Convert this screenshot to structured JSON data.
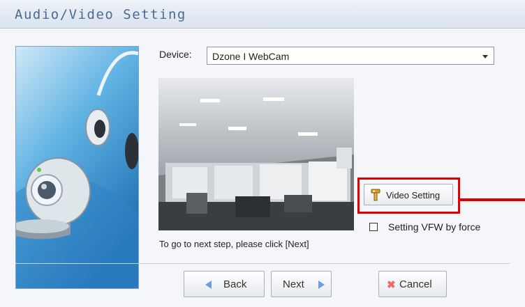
{
  "window": {
    "title": "Audio/Video Setting"
  },
  "device": {
    "label": "Device:",
    "selected": "Dzone I WebCam"
  },
  "preview": {
    "hint": "To go to next step, please click [Next]"
  },
  "video_setting": {
    "label": "Video Setting",
    "icon": "tools-icon"
  },
  "vfw": {
    "label": "Setting VFW by force",
    "checked": false
  },
  "footer": {
    "back_label": "Back",
    "next_label": "Next",
    "cancel_label": "Cancel"
  },
  "colors": {
    "highlight": "#e10000",
    "accent": "#4a6a94",
    "arrow": "#6c9fe0"
  }
}
